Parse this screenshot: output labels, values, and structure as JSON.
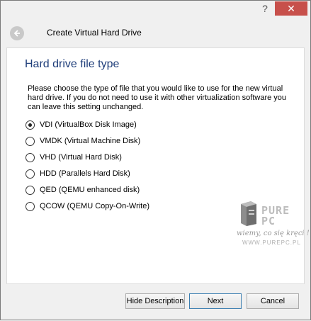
{
  "window": {
    "help_label": "?",
    "close_label": "✕"
  },
  "header": {
    "title": "Create Virtual Hard Drive"
  },
  "page": {
    "heading": "Hard drive file type",
    "description": "Please choose the type of file that you would like to use for the new virtual hard drive. If you do not need to use it with other virtualization software you can leave this setting unchanged."
  },
  "options": [
    {
      "label": "VDI (VirtualBox Disk Image)",
      "checked": true
    },
    {
      "label": "VMDK (Virtual Machine Disk)",
      "checked": false
    },
    {
      "label": "VHD (Virtual Hard Disk)",
      "checked": false
    },
    {
      "label": "HDD (Parallels Hard Disk)",
      "checked": false
    },
    {
      "label": "QED (QEMU enhanced disk)",
      "checked": false
    },
    {
      "label": "QCOW (QEMU Copy-On-Write)",
      "checked": false
    }
  ],
  "watermark": {
    "logo_line1": "PURE",
    "logo_line2": "PC",
    "tagline": "wiemy, co się kręci !",
    "url": "WWW.PUREPC.PL"
  },
  "footer": {
    "hide_description_label": "Hide Description",
    "next_label": "Next",
    "cancel_label": "Cancel"
  },
  "colors": {
    "heading": "#1f3e7a",
    "close_button": "#c7504b"
  }
}
